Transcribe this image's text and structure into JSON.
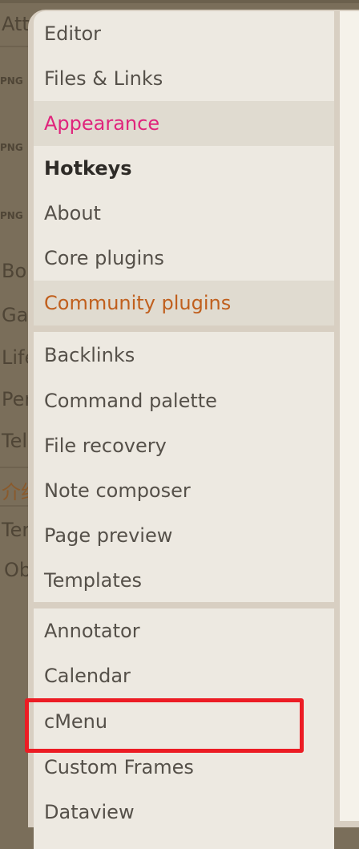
{
  "background": {
    "fragments": [
      "Att",
      "PNG",
      "PNG",
      "PNG",
      "Bo",
      "Ga",
      "Life",
      "Per",
      "Tel",
      "介绍",
      "Ter",
      "Ob"
    ]
  },
  "settings_nav": {
    "options": [
      {
        "label": "Editor"
      },
      {
        "label": "Files & Links"
      },
      {
        "label": "Appearance"
      },
      {
        "label": "Hotkeys"
      },
      {
        "label": "About"
      },
      {
        "label": "Core plugins"
      },
      {
        "label": "Community plugins"
      }
    ],
    "core_plugins": [
      {
        "label": "Backlinks"
      },
      {
        "label": "Command palette"
      },
      {
        "label": "File recovery"
      },
      {
        "label": "Note composer"
      },
      {
        "label": "Page preview"
      },
      {
        "label": "Templates"
      }
    ],
    "community_plugins": [
      {
        "label": "Annotator"
      },
      {
        "label": "Calendar"
      },
      {
        "label": "cMenu"
      },
      {
        "label": "Custom Frames"
      },
      {
        "label": "Dataview"
      }
    ]
  },
  "colors": {
    "accent_pink": "#e0247c",
    "accent_orange": "#c05f1d",
    "highlight_box": "#ec1c24"
  }
}
